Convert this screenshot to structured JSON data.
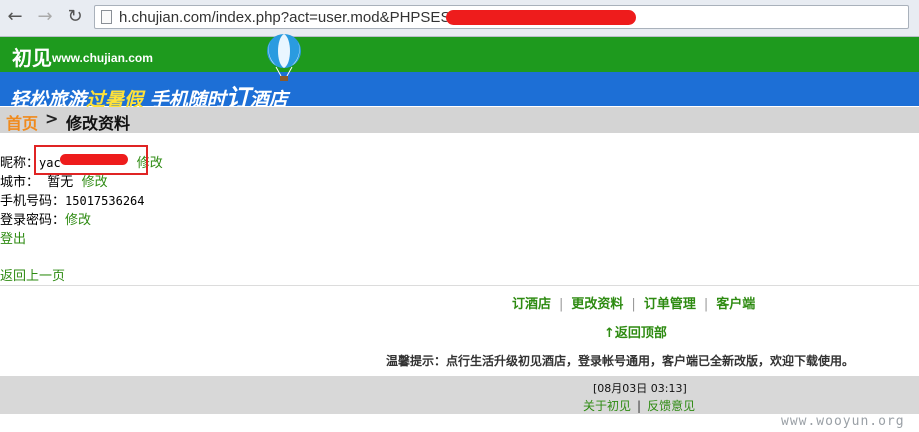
{
  "browser": {
    "url": "h.chujian.com/index.php?act=user.mod&PHPSESSID="
  },
  "header": {
    "logo_text": "初见",
    "logo_url": "www.chujian.com",
    "banner_1": "轻松旅游",
    "banner_2": "过暑假",
    "banner_3": "手机随时",
    "banner_4": "订",
    "banner_5": "酒店"
  },
  "breadcrumb": {
    "home": "首页",
    "separator": ">",
    "current": "修改资料"
  },
  "profile": {
    "nickname_label": "昵称：",
    "nickname_value": "yac",
    "nickname_edit": "修改",
    "city_label": "城市：",
    "city_value": "暂无",
    "city_edit": "修改",
    "phone_label": "手机号码：",
    "phone_value": "15017536264",
    "password_label": "登录密码：",
    "password_edit": "修改",
    "logout": "登出",
    "back": "返回上一页"
  },
  "footer": {
    "nav": [
      "订酒店",
      "更改资料",
      "订单管理",
      "客户端"
    ],
    "back_to_top": "↑返回顶部",
    "tip": "温馨提示：点行生活升级初见酒店，登录帐号通用，客户端已全新改版，欢迎下载使用。",
    "datetime": "[08月03日 03:13]",
    "about": "关于初见",
    "feedback": "反馈意见"
  },
  "watermark": "www.wooyun.org",
  "colors": {
    "green": "#1e9a1e",
    "blue": "#1d6fd6",
    "link": "#2e8b12",
    "redaction": "#ee1c1c"
  }
}
